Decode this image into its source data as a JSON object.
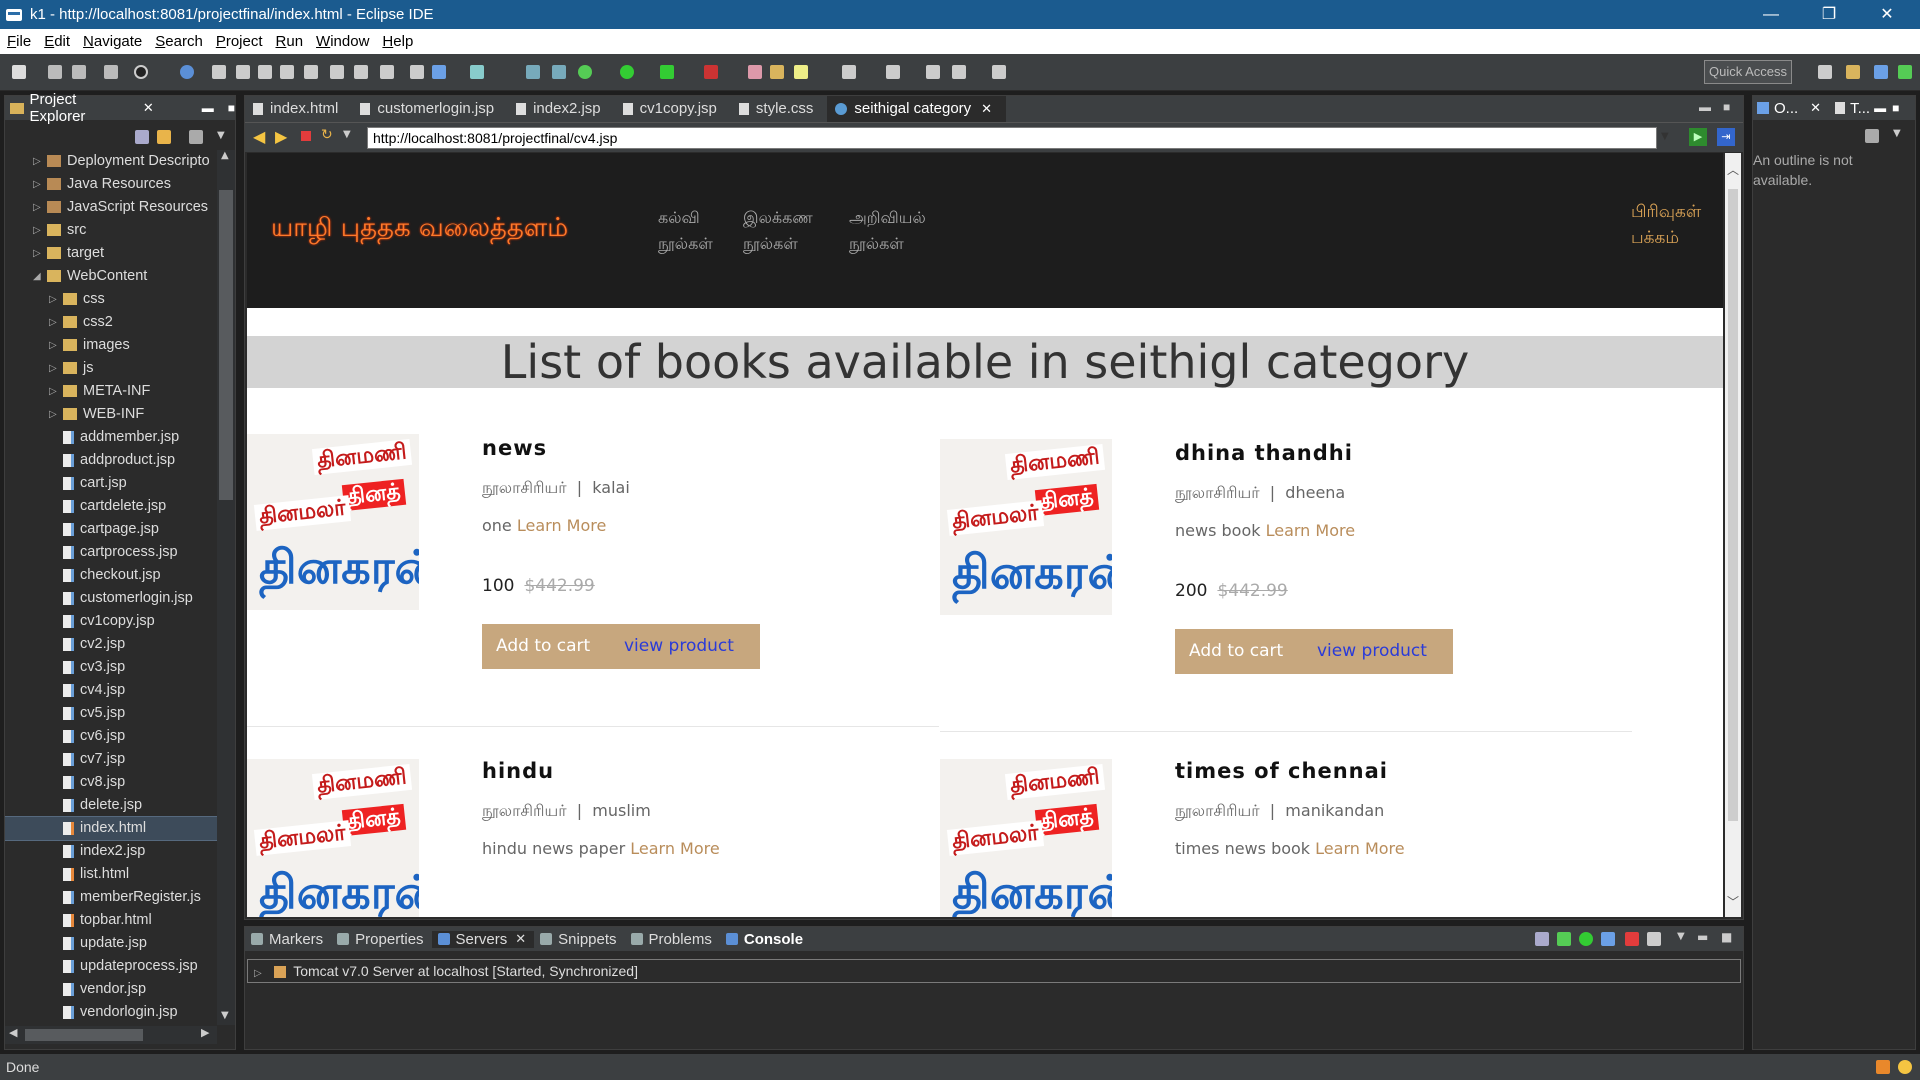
{
  "window": {
    "title": "k1 - http://localhost:8081/projectfinal/index.html - Eclipse IDE"
  },
  "menu": [
    "File",
    "Edit",
    "Navigate",
    "Search",
    "Project",
    "Run",
    "Window",
    "Help"
  ],
  "toolbar": {
    "quick_access": "Quick Access"
  },
  "project_explorer": {
    "title": "Project Explorer",
    "items": [
      {
        "label": "Deployment Descripto",
        "kind": "res",
        "indent": 1,
        "arrow": "▷"
      },
      {
        "label": "Java Resources",
        "kind": "res",
        "indent": 1,
        "arrow": "▷"
      },
      {
        "label": "JavaScript Resources",
        "kind": "res",
        "indent": 1,
        "arrow": "▷"
      },
      {
        "label": "src",
        "kind": "fold",
        "indent": 1,
        "arrow": "▷"
      },
      {
        "label": "target",
        "kind": "fold",
        "indent": 1,
        "arrow": "▷"
      },
      {
        "label": "WebContent",
        "kind": "fold",
        "indent": 1,
        "arrow": "◢"
      },
      {
        "label": "css",
        "kind": "fold",
        "indent": 2,
        "arrow": "▷"
      },
      {
        "label": "css2",
        "kind": "fold",
        "indent": 2,
        "arrow": "▷"
      },
      {
        "label": "images",
        "kind": "fold",
        "indent": 2,
        "arrow": "▷"
      },
      {
        "label": "js",
        "kind": "fold",
        "indent": 2,
        "arrow": "▷"
      },
      {
        "label": "META-INF",
        "kind": "fold",
        "indent": 2,
        "arrow": "▷"
      },
      {
        "label": "WEB-INF",
        "kind": "fold",
        "indent": 2,
        "arrow": "▷"
      },
      {
        "label": "addmember.jsp",
        "kind": "jsp",
        "indent": 2
      },
      {
        "label": "addproduct.jsp",
        "kind": "jsp",
        "indent": 2
      },
      {
        "label": "cart.jsp",
        "kind": "jsp",
        "indent": 2
      },
      {
        "label": "cartdelete.jsp",
        "kind": "jsp",
        "indent": 2
      },
      {
        "label": "cartpage.jsp",
        "kind": "jsp",
        "indent": 2
      },
      {
        "label": "cartprocess.jsp",
        "kind": "jsp",
        "indent": 2
      },
      {
        "label": "checkout.jsp",
        "kind": "jsp",
        "indent": 2
      },
      {
        "label": "customerlogin.jsp",
        "kind": "jsp",
        "indent": 2
      },
      {
        "label": "cv1copy.jsp",
        "kind": "jsp",
        "indent": 2
      },
      {
        "label": "cv2.jsp",
        "kind": "jsp",
        "indent": 2
      },
      {
        "label": "cv3.jsp",
        "kind": "jsp",
        "indent": 2
      },
      {
        "label": "cv4.jsp",
        "kind": "jsp",
        "indent": 2
      },
      {
        "label": "cv5.jsp",
        "kind": "jsp",
        "indent": 2
      },
      {
        "label": "cv6.jsp",
        "kind": "jsp",
        "indent": 2
      },
      {
        "label": "cv7.jsp",
        "kind": "jsp",
        "indent": 2
      },
      {
        "label": "cv8.jsp",
        "kind": "jsp",
        "indent": 2
      },
      {
        "label": "delete.jsp",
        "kind": "jsp",
        "indent": 2
      },
      {
        "label": "index.html",
        "kind": "html",
        "indent": 2,
        "selected": true
      },
      {
        "label": "index2.jsp",
        "kind": "jsp",
        "indent": 2
      },
      {
        "label": "list.html",
        "kind": "html",
        "indent": 2
      },
      {
        "label": "memberRegister.js",
        "kind": "jsp",
        "indent": 2
      },
      {
        "label": "topbar.html",
        "kind": "html",
        "indent": 2
      },
      {
        "label": "update.jsp",
        "kind": "jsp",
        "indent": 2
      },
      {
        "label": "updateprocess.jsp",
        "kind": "jsp",
        "indent": 2
      },
      {
        "label": "vendor.jsp",
        "kind": "jsp",
        "indent": 2
      },
      {
        "label": "vendorlogin.jsp",
        "kind": "jsp",
        "indent": 2
      }
    ]
  },
  "editor": {
    "tabs": [
      {
        "label": "index.html"
      },
      {
        "label": "customerlogin.jsp"
      },
      {
        "label": "index2.jsp"
      },
      {
        "label": "cv1copy.jsp"
      },
      {
        "label": "style.css"
      },
      {
        "label": "seithigal category",
        "active": true
      }
    ],
    "url": "http://localhost:8081/projectfinal/cv4.jsp"
  },
  "site": {
    "logo": "யாழி புத்தக வலைத்தளம்",
    "nav": [
      {
        "line1": "கல்வி",
        "line2": "நூல்கள்"
      },
      {
        "line1": "இலக்கண",
        "line2": "நூல்கள்"
      },
      {
        "line1": "அறிவியல்",
        "line2": "நூல்கள்"
      }
    ],
    "category_link": {
      "line1": "பிரிவுகள்",
      "line2": "பக்கம்"
    },
    "banner": "List of books available in seithigl category",
    "author_label": "நூலாசிரியர்",
    "learn_more": "Learn More",
    "add_to_cart": "Add to cart",
    "view_product": "view product",
    "old_price": "$442.99",
    "products": [
      {
        "title": "news",
        "author": "kalai",
        "desc": "one",
        "price": "100"
      },
      {
        "title": "dhina thandhi",
        "author": "dheena",
        "desc": "news book",
        "price": "200"
      },
      {
        "title": "hindu",
        "author": "muslim",
        "desc": "hindu news paper",
        "price": ""
      },
      {
        "title": "times of chennai",
        "author": "manikandan",
        "desc": "times news book",
        "price": ""
      }
    ],
    "paper_texts": {
      "dinamani": "தினமணி",
      "dinathanthi": "தினத்",
      "dinamalar": "தினமலர்",
      "dinakaran": "தினகரன்"
    }
  },
  "outline": {
    "tab1": "O...",
    "tab2": "T...",
    "message": "An outline is not available."
  },
  "console": {
    "tabs": [
      {
        "label": "Markers"
      },
      {
        "label": "Properties"
      },
      {
        "label": "Servers"
      },
      {
        "label": "Snippets"
      },
      {
        "label": "Problems"
      },
      {
        "label": "Console",
        "active": true
      }
    ],
    "server": "Tomcat v7.0 Server at localhost  [Started, Synchronized]"
  },
  "status": {
    "text": "Done"
  }
}
